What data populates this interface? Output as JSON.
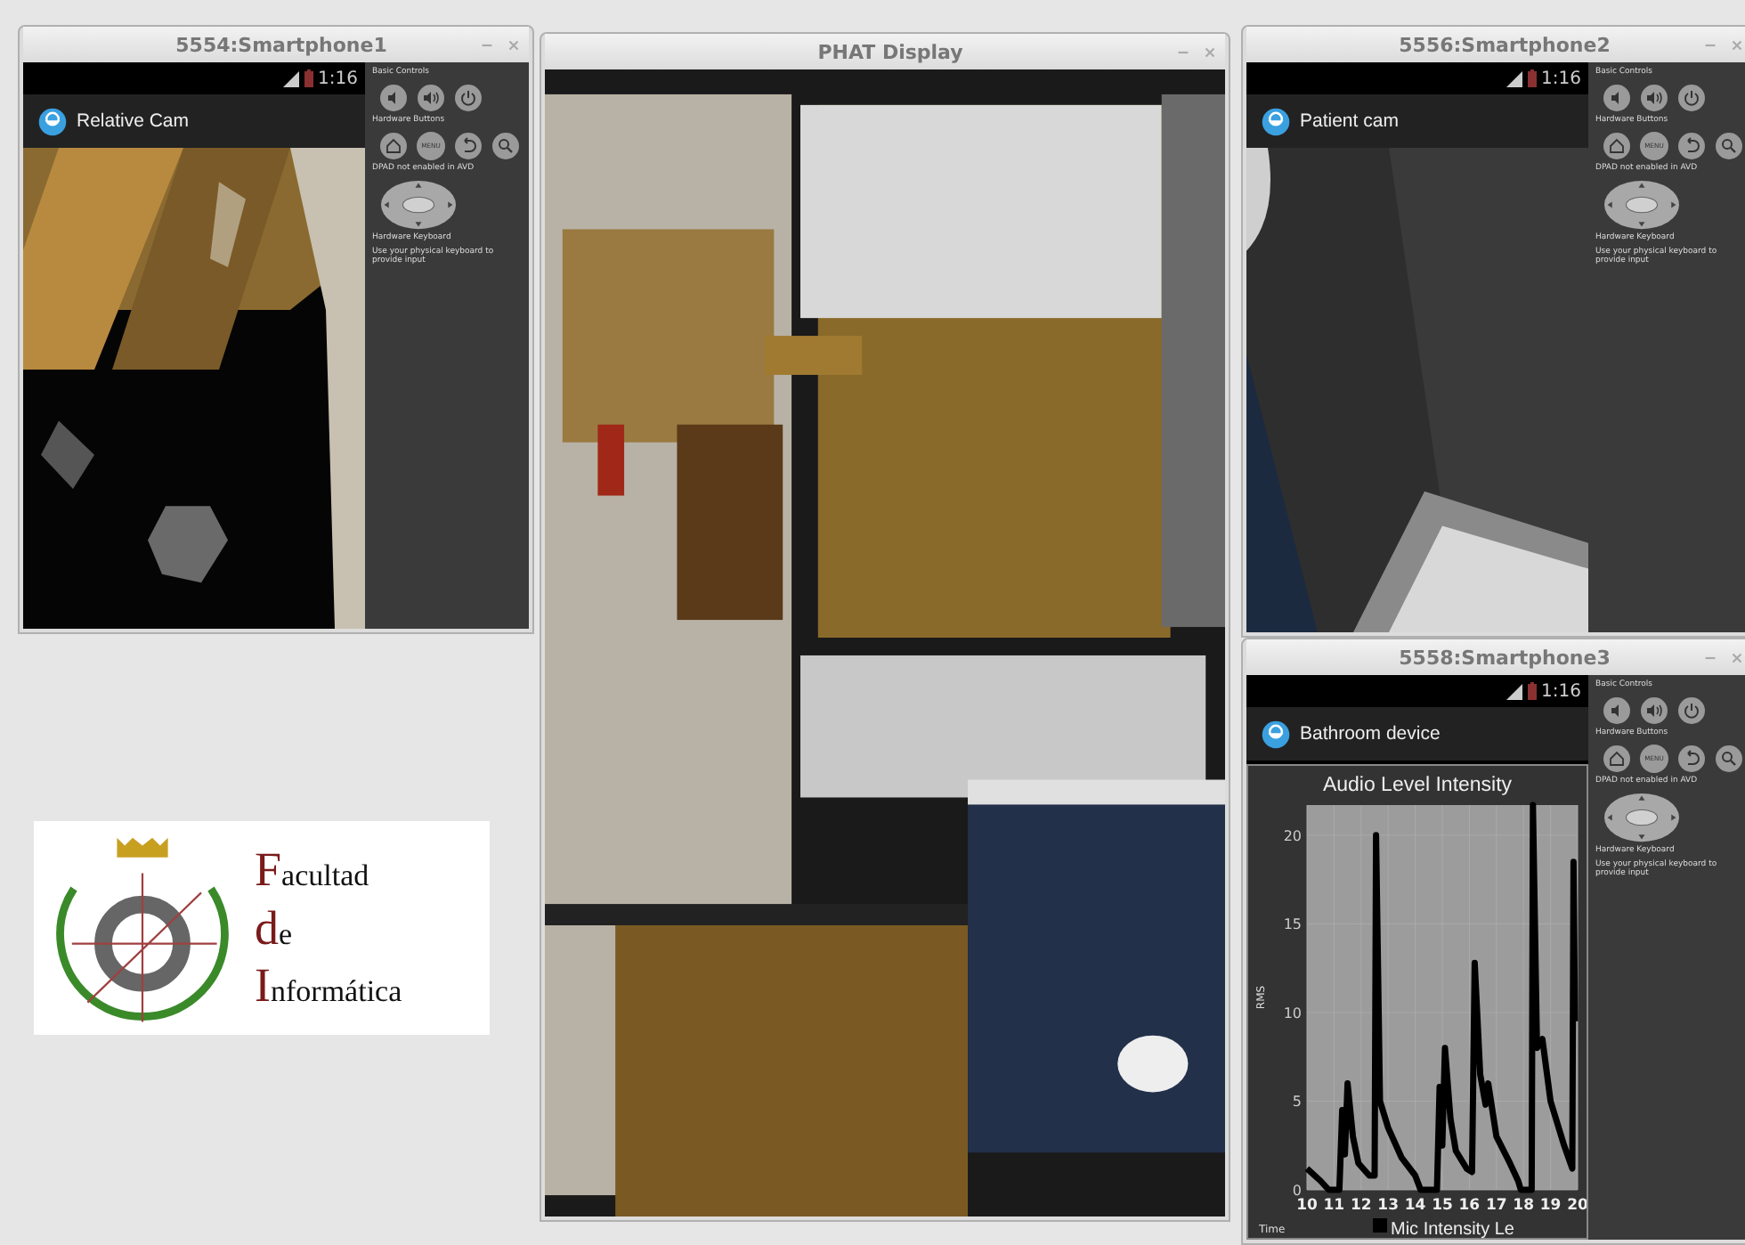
{
  "windows": [
    {
      "kind": "emulator",
      "title": "5554:Smartphone1",
      "time": "1:16",
      "app_title": "Relative Cam",
      "controls": {
        "basic_label": "Basic Controls",
        "hardware_label": "Hardware Buttons",
        "menu_key": "MENU",
        "dpad_label": "DPAD not enabled in AVD",
        "keyboard_label": "Hardware Keyboard",
        "keyboard_hint": "Use your physical keyboard to provide input"
      }
    },
    {
      "kind": "display",
      "title": "PHAT Display"
    },
    {
      "kind": "emulator",
      "title": "5556:Smartphone2",
      "time": "1:16",
      "app_title": "Patient cam",
      "controls": {
        "basic_label": "Basic Controls",
        "hardware_label": "Hardware Buttons",
        "menu_key": "MENU",
        "dpad_label": "DPAD not enabled in AVD",
        "keyboard_label": "Hardware Keyboard",
        "keyboard_hint": "Use your physical keyboard to provide input"
      }
    },
    {
      "kind": "emulator",
      "title": "5558:Smartphone3",
      "time": "1:16",
      "app_title": "Bathroom device",
      "content": {
        "kind": "chart",
        "chart_data": {
          "type": "line",
          "grid": true,
          "title": "Audio Level Intensity",
          "xlabel": "Time",
          "ylabel": "RMS",
          "x": [
            10,
            10.5,
            10.8,
            11.2,
            11.3,
            11.4,
            11.5,
            11.7,
            11.9,
            12.3,
            12.5,
            12.55,
            12.7,
            13,
            13.5,
            14,
            14.2,
            14.8,
            14.9,
            15,
            15.1,
            15.3,
            15.5,
            15.9,
            16.1,
            16.2,
            16.4,
            16.6,
            16.7,
            17,
            17.5,
            17.8,
            17.9,
            18.3,
            18.35,
            18.5,
            18.7,
            19,
            19.5,
            19.8,
            19.85,
            19.9
          ],
          "series": [
            {
              "name": "Mic Intensity Le",
              "color": "#000000",
              "values": [
                1.2,
                0.5,
                0,
                0,
                4.5,
                2,
                6,
                3,
                1.5,
                0.8,
                0.8,
                20,
                5,
                3.5,
                1.8,
                0.8,
                0,
                0,
                5.8,
                2.5,
                8,
                4,
                2.2,
                1.2,
                1,
                12.8,
                6.5,
                4.8,
                6,
                3,
                1.5,
                0.5,
                0,
                0,
                21.7,
                8,
                8.5,
                5,
                2.5,
                1.2,
                18.5,
                9.5
              ]
            }
          ],
          "xlim": [
            10,
            20
          ],
          "ylim": [
            0,
            21.7
          ],
          "xticks": [
            10,
            11,
            12,
            13,
            14,
            15,
            16,
            17,
            18,
            19,
            20
          ],
          "yticks": [
            0,
            5,
            10,
            15,
            20
          ]
        }
      },
      "controls": {
        "basic_label": "Basic Controls",
        "hardware_label": "Hardware Buttons",
        "menu_key": "MENU",
        "dpad_label": "DPAD not enabled in AVD",
        "keyboard_label": "Hardware Keyboard",
        "keyboard_hint": "Use your physical keyboard to provide input"
      }
    }
  ],
  "logo": {
    "lines": [
      {
        "initial": "F",
        "rest": "acultad"
      },
      {
        "initial": "d",
        "rest": "e"
      },
      {
        "initial": "I",
        "rest": "nformática"
      }
    ]
  }
}
